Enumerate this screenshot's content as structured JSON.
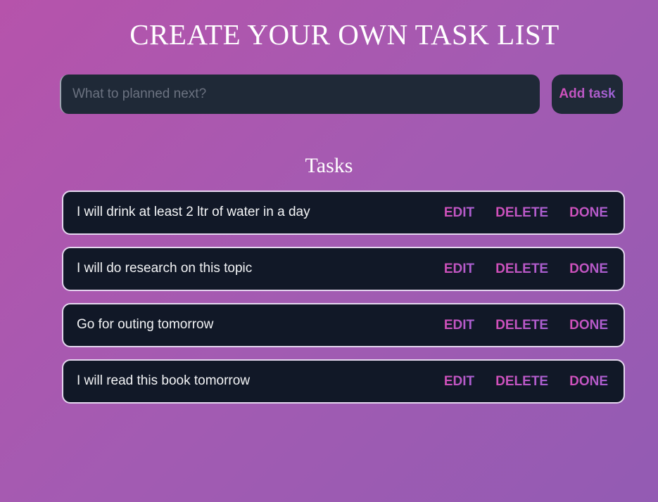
{
  "header": {
    "title": "CREATE YOUR OWN TASK LIST"
  },
  "form": {
    "input_value": "",
    "input_placeholder": "What to planned next?",
    "add_label": "Add task"
  },
  "tasks_section": {
    "heading": "Tasks",
    "edit_label": "EDIT",
    "delete_label": "DELETE",
    "done_label": "DONE",
    "items": [
      {
        "text": "I will drink at least 2 ltr of water in a day"
      },
      {
        "text": "I will do research on this topic"
      },
      {
        "text": "Go for outing tomorrow"
      },
      {
        "text": "I will read this book tomorrow"
      }
    ]
  },
  "colors": {
    "background_start": "#b653ab",
    "background_end": "#935bb3",
    "card": "#111827",
    "input": "#1f2937",
    "accent_pink": "#d34fb9",
    "accent_purple": "#9a64d6"
  }
}
